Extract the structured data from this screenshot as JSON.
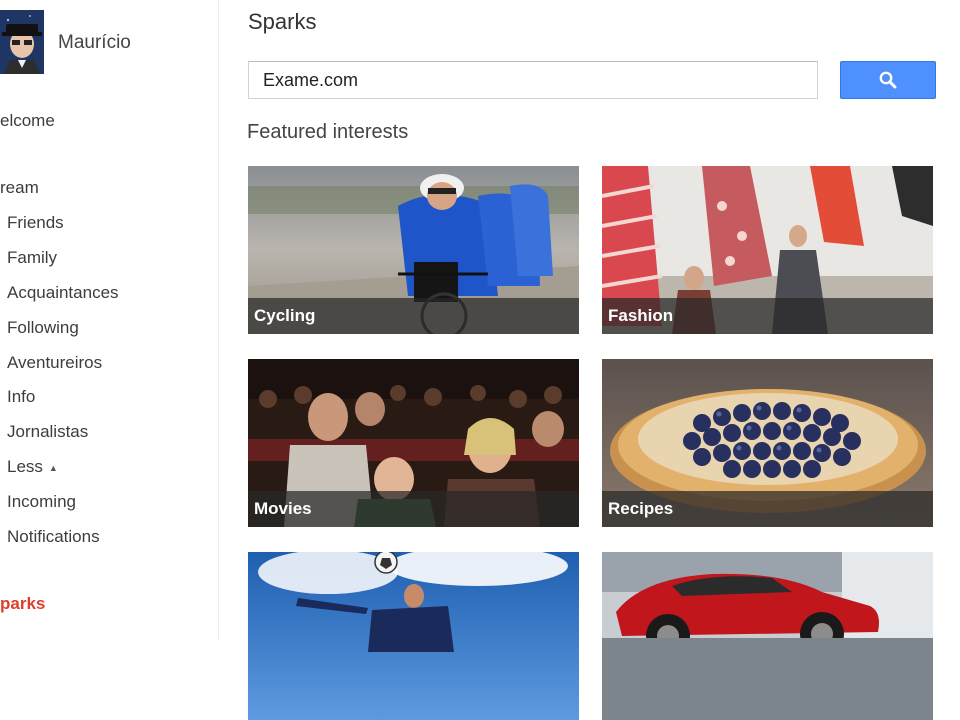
{
  "profile": {
    "name": "Maurício"
  },
  "sidebar": {
    "items": [
      {
        "label": "elcome",
        "level": "top",
        "active": false
      },
      {
        "label": "ream",
        "level": "top",
        "active": false
      },
      {
        "label": "Friends",
        "level": "sub",
        "active": false
      },
      {
        "label": "Family",
        "level": "sub",
        "active": false
      },
      {
        "label": "Acquaintances",
        "level": "sub",
        "active": false
      },
      {
        "label": "Following",
        "level": "sub",
        "active": false
      },
      {
        "label": "Aventureiros",
        "level": "sub",
        "active": false
      },
      {
        "label": "Info",
        "level": "sub",
        "active": false
      },
      {
        "label": "Jornalistas",
        "level": "sub",
        "active": false
      },
      {
        "label": "Less",
        "level": "sub",
        "active": false
      },
      {
        "label": "Incoming",
        "level": "sub",
        "active": false
      },
      {
        "label": "Notifications",
        "level": "sub",
        "active": false
      },
      {
        "label": "parks",
        "level": "top",
        "active": true
      }
    ]
  },
  "main": {
    "title": "Sparks",
    "search": {
      "value": "Exame.com",
      "button_icon": "search-icon"
    },
    "section_heading": "Featured interests",
    "tiles": [
      {
        "label": "Cycling"
      },
      {
        "label": "Fashion"
      },
      {
        "label": "Movies"
      },
      {
        "label": "Recipes"
      },
      {
        "label": ""
      },
      {
        "label": ""
      }
    ]
  },
  "colors": {
    "accent_blue": "#4d90fe",
    "active_red": "#dd3f2b",
    "label_bar": "#282828"
  }
}
